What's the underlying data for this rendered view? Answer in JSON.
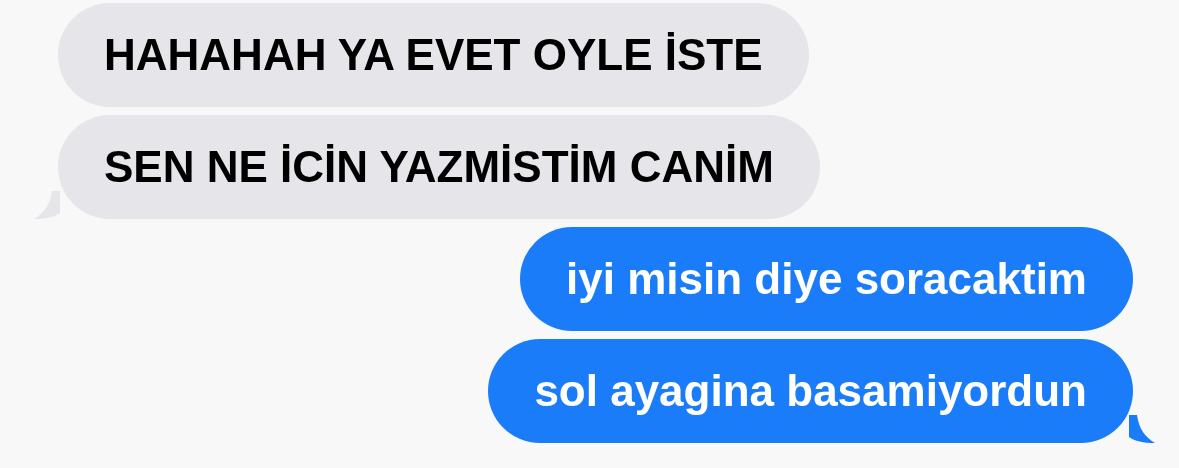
{
  "messages": [
    {
      "kind": "incoming",
      "text": "HAHAHAH YA EVET OYLE İSTE",
      "tail": false
    },
    {
      "kind": "incoming",
      "text": "SEN NE İCİN YAZMİSTİM CANİM",
      "tail": true
    },
    {
      "kind": "outgoing",
      "text": "iyi misin diye soracaktim",
      "tail": false
    },
    {
      "kind": "outgoing",
      "text": "sol ayagina basamiyordun",
      "tail": true
    }
  ]
}
